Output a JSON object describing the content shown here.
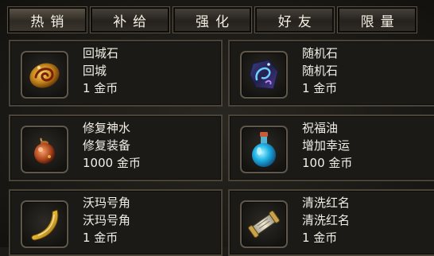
{
  "tabs": [
    {
      "label": "热销",
      "active": true
    },
    {
      "label": "补给",
      "active": false
    },
    {
      "label": "强化",
      "active": false
    },
    {
      "label": "好友",
      "active": false
    },
    {
      "label": "限量",
      "active": false
    }
  ],
  "items": [
    {
      "name": "回城石",
      "desc": "回城",
      "price": "1 金币",
      "icon": "return-stone-icon"
    },
    {
      "name": "随机石",
      "desc": "随机石",
      "price": "1 金币",
      "icon": "random-stone-icon"
    },
    {
      "name": "修复神水",
      "desc": "修复装备",
      "price": "1000 金币",
      "icon": "repair-potion-icon"
    },
    {
      "name": "祝福油",
      "desc": "增加幸运",
      "price": "100 金币",
      "icon": "blessing-oil-icon"
    },
    {
      "name": "沃玛号角",
      "desc": "沃玛号角",
      "price": "1 金币",
      "icon": "woma-horn-icon"
    },
    {
      "name": "清洗红名",
      "desc": "清洗红名",
      "price": "1 金币",
      "icon": "scroll-icon"
    }
  ]
}
